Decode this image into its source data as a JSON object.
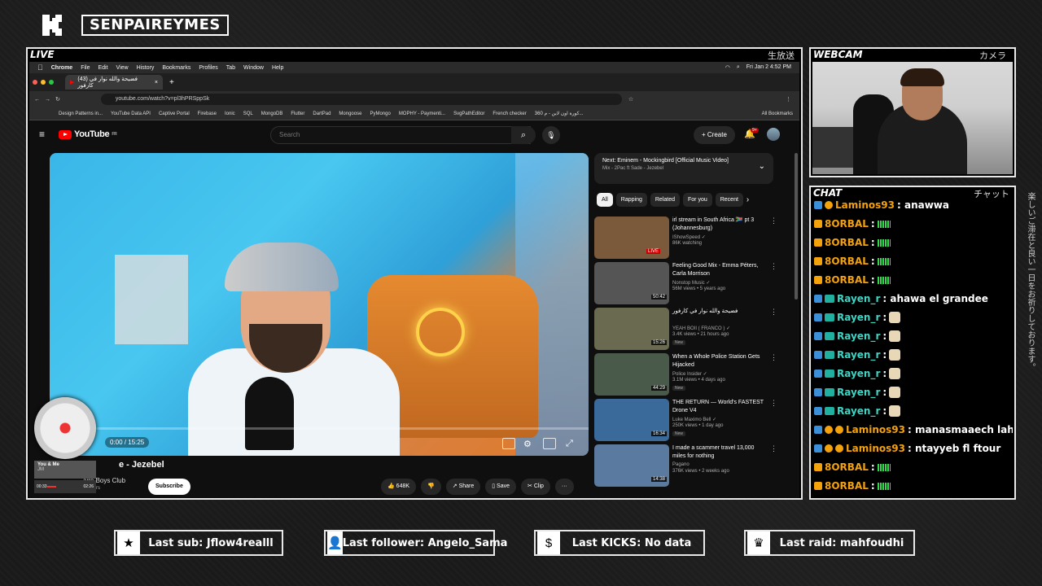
{
  "header": {
    "brand": "SENPAIREYMES"
  },
  "panels": {
    "live_tag": "LIVE",
    "live_jp": "生放送",
    "webcam_tag": "WEBCAM",
    "webcam_jp": "カメラ",
    "chat_tag": "CHAT",
    "chat_jp": "チャット"
  },
  "side_vertical_text": "楽しいご滞在と良い一日をお祈りしております。",
  "macbar": {
    "app": "Chrome",
    "menus": [
      "File",
      "Edit",
      "View",
      "History",
      "Bookmarks",
      "Profiles",
      "Tab",
      "Window",
      "Help"
    ],
    "clock": "Fri Jan 2  4:52 PM"
  },
  "browser": {
    "tab_title": "(43) فضيحة والله نوار في كارفور",
    "url": "youtube.com/watch?v=pl3hPRSppSk",
    "bookmarks": [
      "Design Patterns in...",
      "YouTube Data API",
      "Captive Portal",
      "Firebase",
      "Ionic",
      "SQL",
      "MongoDB",
      "Flutter",
      "DartPad",
      "Mongoose",
      "PyMongo",
      "MOPHY - Paymenti...",
      "SvgPathEditor",
      "French checker",
      "360 كورة اون لاين - م...",
      "All Bookmarks"
    ]
  },
  "youtube": {
    "logo": "YouTube",
    "logo_region": "FR",
    "search_placeholder": "Search",
    "create_label": "Create",
    "notif_count": "9+",
    "video": {
      "time": "0:00 / 15:25",
      "title": "e - Jezebel",
      "channel": "aire Boys Club",
      "subs": "scribers"
    },
    "subscribe_label": "Subscribe",
    "actions": {
      "likes": "648K",
      "share": "Share",
      "save": "Save",
      "clip": "Clip",
      "more": "···"
    },
    "next": {
      "title": "Next: Eminem - Mockingbird [Official Music Video]",
      "sub": "Mix - 2Pac ft Sade - Jezebel"
    },
    "chips": [
      "All",
      "Rapping",
      "Related",
      "For you",
      "Recent"
    ],
    "recs": [
      {
        "title": "irl stream in South Africa 🇿🇦 pt 3 (Johannesburg)",
        "channel": "IShowSpeed ✓",
        "meta": "86K watching",
        "badge": "LIVE",
        "new": "",
        "color": "#7a5a3a"
      },
      {
        "title": "Feeling Good Mix - Emma Péters, Carla Morrison",
        "channel": "Nonstop Music ✓",
        "meta": "56M views • 5 years ago",
        "badge": "50:42",
        "new": "",
        "color": "#555"
      },
      {
        "title": "فضيحة والله نوار في كارفور",
        "channel": "YEAH BOII ( FRANCO ) ✓",
        "meta": "3.4K views • 21 hours ago",
        "badge": "15:26",
        "new": "New",
        "color": "#6a6a50"
      },
      {
        "title": "When a Whole Police Station Gets Hijacked",
        "channel": "Police Insider ✓",
        "meta": "3.1M views • 4 days ago",
        "badge": "44:29",
        "new": "New",
        "color": "#4a5a4a"
      },
      {
        "title": "THE RETURN — World's FASTEST Drone V4",
        "channel": "Luke Maximo Bell ✓",
        "meta": "250K views • 1 day ago",
        "badge": "16:34",
        "new": "New",
        "color": "#3a6a9a"
      },
      {
        "title": "I made a scammer travel 13,000 miles for nothing",
        "channel": "Pagano",
        "meta": "376K views • 2 weeks ago",
        "badge": "14:38",
        "new": "",
        "color": "#5a7aa0"
      }
    ]
  },
  "now_playing": {
    "title": "You & Me",
    "artist": "JM",
    "elapsed": "00:33",
    "total": "02:26",
    "progress": 0.23
  },
  "chat": [
    {
      "user": "Laminos93",
      "text": " : anawwa",
      "style": "o",
      "badges": [
        "b1",
        "b3"
      ],
      "emote": ""
    },
    {
      "user": "8ORBAL",
      "text": " : ",
      "style": "o",
      "badges": [
        "b2"
      ],
      "emote": "eq"
    },
    {
      "user": "8ORBAL",
      "text": " : ",
      "style": "o",
      "badges": [
        "b2"
      ],
      "emote": "eq"
    },
    {
      "user": "8ORBAL",
      "text": " : ",
      "style": "o",
      "badges": [
        "b2"
      ],
      "emote": "eq"
    },
    {
      "user": "8ORBAL",
      "text": " : ",
      "style": "o",
      "badges": [
        "b2"
      ],
      "emote": "eq"
    },
    {
      "user": "Rayen_r",
      "text": " : ahawa el grandee",
      "style": "t",
      "badges": [
        "b1",
        "b4"
      ],
      "emote": ""
    },
    {
      "user": "Rayen_r",
      "text": " : ",
      "style": "t",
      "badges": [
        "b1",
        "b4"
      ],
      "emote": "face"
    },
    {
      "user": "Rayen_r",
      "text": " : ",
      "style": "t",
      "badges": [
        "b1",
        "b4"
      ],
      "emote": "face"
    },
    {
      "user": "Rayen_r",
      "text": " : ",
      "style": "t",
      "badges": [
        "b1",
        "b4"
      ],
      "emote": "face"
    },
    {
      "user": "Rayen_r",
      "text": " : ",
      "style": "t",
      "badges": [
        "b1",
        "b4"
      ],
      "emote": "face"
    },
    {
      "user": "Rayen_r",
      "text": " : ",
      "style": "t",
      "badges": [
        "b1",
        "b4"
      ],
      "emote": "face"
    },
    {
      "user": "Rayen_r",
      "text": " : ",
      "style": "t",
      "badges": [
        "b1",
        "b4"
      ],
      "emote": "face"
    },
    {
      "user": "Laminos93",
      "text": " : manasmaaech lahdha",
      "style": "o",
      "badges": [
        "b1",
        "b3",
        "b3"
      ],
      "emote": ""
    },
    {
      "user": "Laminos93",
      "text": " : ntayyeb fl ftour",
      "style": "o",
      "badges": [
        "b1",
        "b3",
        "b3"
      ],
      "emote": ""
    },
    {
      "user": "8ORBAL",
      "text": " : ",
      "style": "o",
      "badges": [
        "b2"
      ],
      "emote": "eq"
    },
    {
      "user": "8ORBAL",
      "text": " : ",
      "style": "o",
      "badges": [
        "b2"
      ],
      "emote": "eq"
    }
  ],
  "footer": {
    "last_sub": "Last sub: Jflow4realll",
    "last_follower": "Last follower: Angelo_Sama",
    "last_kicks": "Last KICKS: No data",
    "last_raid": "Last raid: mahfoudhi"
  }
}
